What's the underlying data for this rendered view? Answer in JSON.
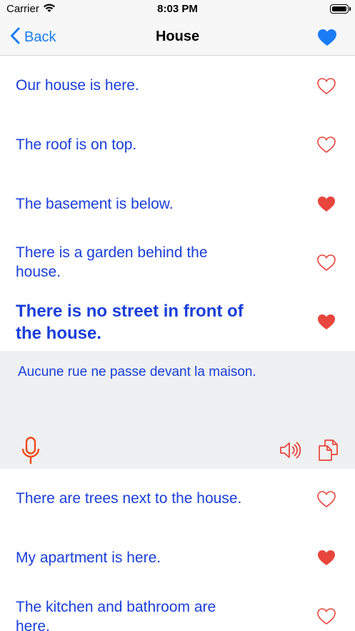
{
  "status_bar": {
    "carrier": "Carrier",
    "time": "8:03 PM"
  },
  "nav": {
    "back_label": "Back",
    "title": "House",
    "heart_color": "#1a7cf5"
  },
  "colors": {
    "phrase_text": "#1a3fd9",
    "heart_red": "#e8453c",
    "expanded_bg": "#eff0f1",
    "icon_orange": "#ee4a1a"
  },
  "phrases": [
    {
      "text": "Our house is here.",
      "favorite": false
    },
    {
      "text": "The roof is on top.",
      "favorite": false
    },
    {
      "text": "The basement is below.",
      "favorite": true
    },
    {
      "text": "There is a garden behind the house.",
      "favorite": false
    },
    {
      "text": "There is no street in front of the house.",
      "favorite": true,
      "selected": true
    },
    {
      "text": "There are trees next to the house.",
      "favorite": false
    },
    {
      "text": "My apartment is here.",
      "favorite": true
    },
    {
      "text": "The kitchen and bathroom are here.",
      "favorite": false
    }
  ],
  "expanded": {
    "translation": "Aucune rue ne passe devant la maison."
  }
}
